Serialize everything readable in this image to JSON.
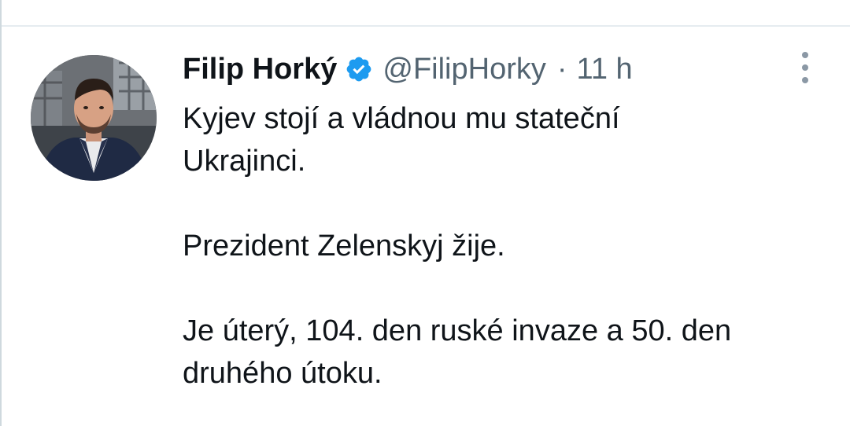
{
  "tweet": {
    "author": {
      "display_name": "Filip Horký",
      "handle": "@FilipHorky",
      "verified": true,
      "verified_icon": "verified-badge-icon",
      "avatar": "profile-photo"
    },
    "separator": "·",
    "time": "11 h",
    "more_icon": "more-options-icon",
    "paragraphs": [
      "Kyjev stojí a vládnou mu stateční\nUkrajinci.",
      "Prezident Zelenskyj žije.",
      "Je úterý, 104. den ruské invaze a 50. den\ndruhého útoku."
    ]
  },
  "colors": {
    "text": "#0f1419",
    "secondary_text": "#536471",
    "verified_blue": "#1d9bf0",
    "divider": "#e6ecf0"
  }
}
